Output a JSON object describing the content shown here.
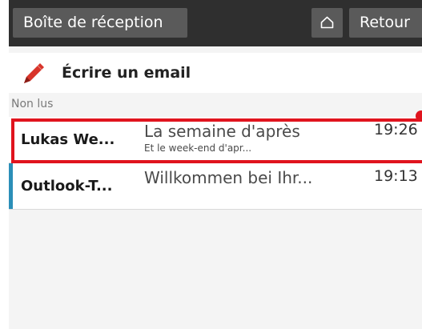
{
  "toolbar": {
    "inbox_label": "Boîte de réception",
    "home_icon": "home-icon",
    "back_label": "Retour"
  },
  "compose": {
    "icon": "pencil-icon",
    "label": "Écrire un email"
  },
  "section": {
    "label": "Non lus"
  },
  "emails": [
    {
      "sender": "Lukas We...",
      "subject": "La semaine d'après",
      "preview": "Et le week-end d'apr...",
      "time": "19:26",
      "highlighted": true
    },
    {
      "sender": "Outlook-T...",
      "subject": "Willkommen bei Ihr...",
      "preview": "",
      "time": "19:13",
      "unread_bar_color": "#2b8fb8"
    }
  ],
  "colors": {
    "toolbar_bg": "#2f2f2f",
    "button_bg": "#5a5a5a",
    "highlight": "#e0141e",
    "accent_bar": "#2b8fb8",
    "pencil": "#d8342a"
  }
}
